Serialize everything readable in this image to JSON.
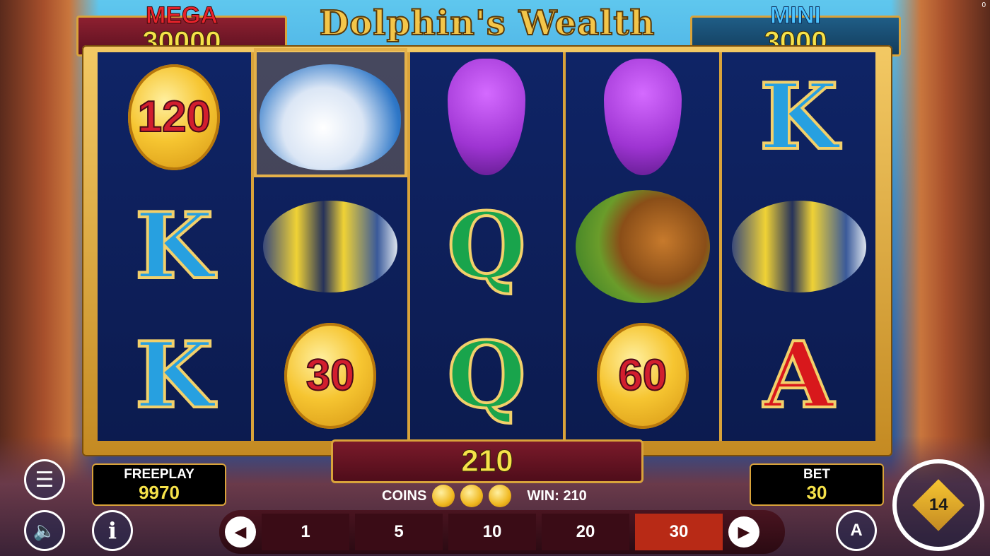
{
  "game": {
    "title": "Dolphin's Wealth",
    "corner_counter": "0"
  },
  "jackpots": {
    "mega": {
      "label": "MEGA",
      "value": "30000"
    },
    "mini": {
      "label": "MINI",
      "value": "3000"
    }
  },
  "reels": [
    [
      {
        "type": "coin",
        "value": "120"
      },
      {
        "type": "letter",
        "letter": "K"
      },
      {
        "type": "letter",
        "letter": "K"
      }
    ],
    [
      {
        "type": "dolphin",
        "held": true
      },
      {
        "type": "fish"
      },
      {
        "type": "coin",
        "value": "30"
      }
    ],
    [
      {
        "type": "seahorse"
      },
      {
        "type": "letter",
        "letter": "Q"
      },
      {
        "type": "letter",
        "letter": "Q"
      }
    ],
    [
      {
        "type": "seahorse"
      },
      {
        "type": "turtle"
      },
      {
        "type": "coin",
        "value": "60"
      }
    ],
    [
      {
        "type": "letter",
        "letter": "K"
      },
      {
        "type": "fish"
      },
      {
        "type": "letter",
        "letter": "A"
      }
    ]
  ],
  "win_display": "210",
  "coins": {
    "label": "COINS",
    "win_label": "WIN: 210"
  },
  "freeplay": {
    "label": "FREEPLAY",
    "value": "9970"
  },
  "bet": {
    "label": "BET",
    "value": "30"
  },
  "bet_options": [
    "1",
    "5",
    "10",
    "20",
    "30"
  ],
  "selected_bet": "30",
  "controls": {
    "auto_label": "A",
    "info_label": "i",
    "spin_label": "14"
  },
  "icons": {
    "menu": "menu-icon",
    "sound": "sound-icon",
    "info": "info-icon",
    "auto": "autoplay-icon",
    "spin": "spin-icon",
    "prev": "chevron-left-icon",
    "next": "chevron-right-icon"
  }
}
